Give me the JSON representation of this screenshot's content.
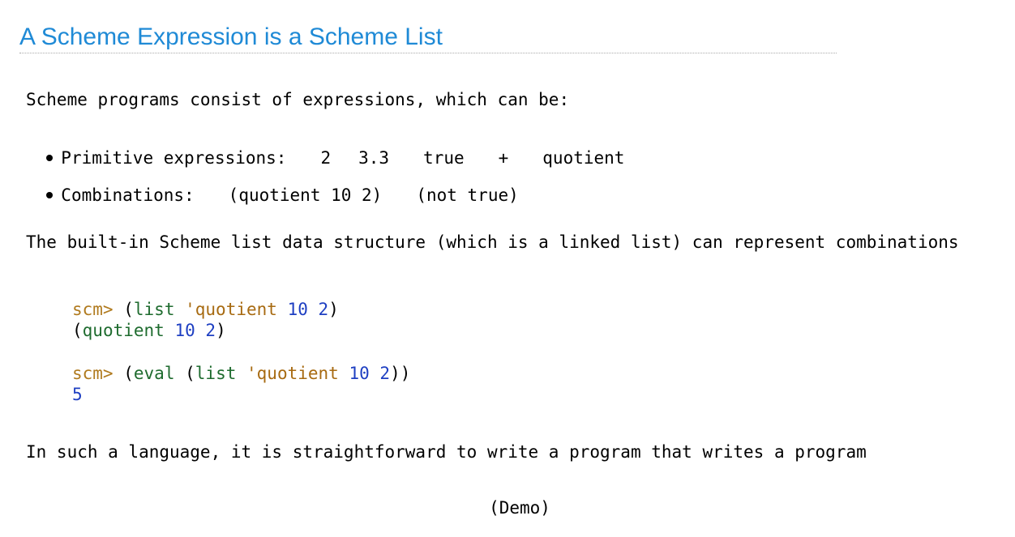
{
  "title": "A Scheme Expression is a Scheme List",
  "intro": "Scheme programs consist of expressions, which can be:",
  "bullets": {
    "primitive": {
      "label": "Primitive expressions:",
      "examples": [
        "2",
        "3.3",
        "true",
        "+",
        "quotient"
      ]
    },
    "combinations": {
      "label": "Combinations:",
      "examples": [
        "(quotient 10 2)",
        "(not true)"
      ]
    }
  },
  "builtin_text": "The built-in Scheme list data structure (which is a linked list) can represent combinations",
  "code": {
    "prompt": "scm>",
    "line1": {
      "open": "(",
      "fn": "list",
      "quoted": "'quotient",
      "n1": "10",
      "n2": "2",
      "close": ")"
    },
    "output1": {
      "open": "(",
      "sym": "quotient",
      "n1": "10",
      "n2": "2",
      "close": ")"
    },
    "line2": {
      "open1": "(",
      "fn1": "eval",
      "open2": "(",
      "fn2": "list",
      "quoted": "'quotient",
      "n1": "10",
      "n2": "2",
      "close": "))"
    },
    "output2": "5"
  },
  "closing_text": "In such a language, it is straightforward to write a program that writes a program",
  "demo": "(Demo)",
  "colors": {
    "title": "#1f8ad6",
    "prompt": "#b07a1e",
    "builtin": "#1e6b2e",
    "quoted": "#a76a11",
    "number": "#1e3fc2"
  }
}
